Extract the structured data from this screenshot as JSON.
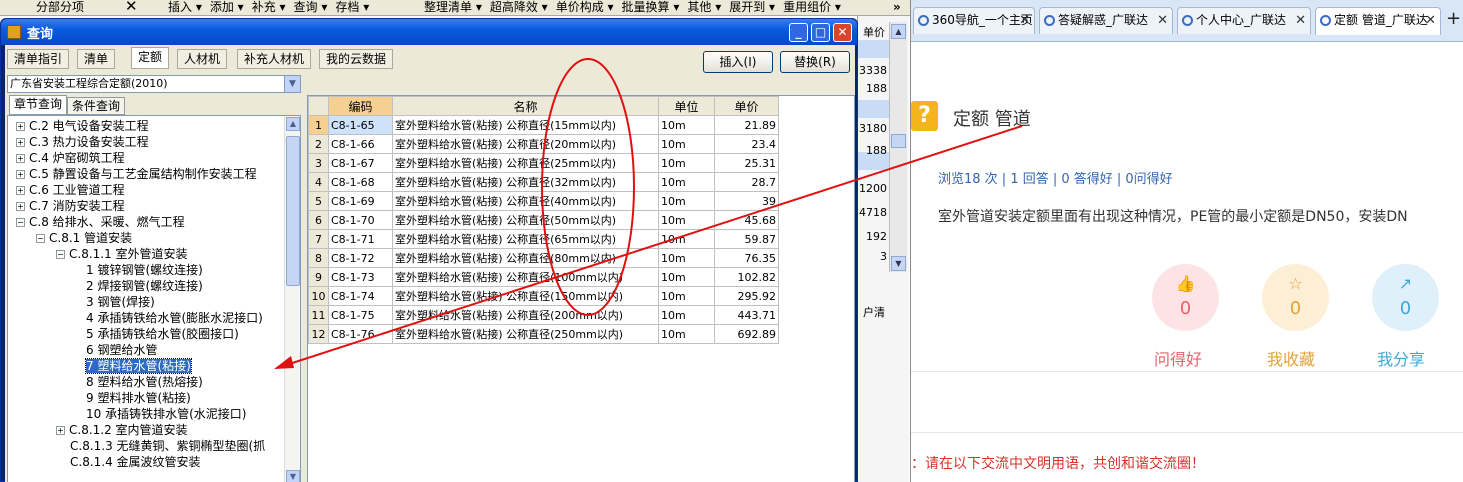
{
  "app_toolbar": {
    "section_label": "分部分项",
    "close": "✕",
    "menus": [
      "插入 ▾",
      "添加 ▾",
      "补充 ▾",
      "查询 ▾",
      "存档 ▾"
    ],
    "menus2": [
      "整理清单 ▾",
      "超高降效 ▾",
      "单价构成 ▾",
      "批量换算 ▾",
      "其他 ▾",
      "展开到 ▾",
      "重用组价 ▾"
    ],
    "overflow": "»"
  },
  "bg_column": {
    "header": "单价",
    "values": [
      "3338",
      "188",
      "3180",
      "188",
      "1200",
      "4718",
      "192",
      "3"
    ],
    "tab_text": "户清"
  },
  "dialog": {
    "title": "查询",
    "tabs": [
      "清单指引",
      "清单",
      "定额",
      "人材机",
      "补充人材机",
      "我的云数据"
    ],
    "selected_tab": "定额",
    "insert_button": "插入(I)",
    "replace_button": "替换(R)",
    "quota_library": "广东省安装工程综合定额(2010)",
    "left_tabs": [
      "章节查询",
      "条件查询"
    ],
    "tree": [
      {
        "label": "C.2 电气设备安装工程",
        "level": 0,
        "toggle": "+"
      },
      {
        "label": "C.3 热力设备安装工程",
        "level": 0,
        "toggle": "+"
      },
      {
        "label": "C.4 炉窑砌筑工程",
        "level": 0,
        "toggle": "+"
      },
      {
        "label": "C.5 静置设备与工艺金属结构制作安装工程",
        "level": 0,
        "toggle": "+"
      },
      {
        "label": "C.6 工业管道工程",
        "level": 0,
        "toggle": "+"
      },
      {
        "label": "C.7 消防安装工程",
        "level": 0,
        "toggle": "+"
      },
      {
        "label": "C.8 给排水、采暖、燃气工程",
        "level": 0,
        "toggle": "−"
      },
      {
        "label": "C.8.1 管道安装",
        "level": 1,
        "toggle": "−"
      },
      {
        "label": "C.8.1.1 室外管道安装",
        "level": 2,
        "toggle": "−"
      },
      {
        "label": "1 镀锌钢管(螺纹连接)",
        "level": 3,
        "toggle": ""
      },
      {
        "label": "2 焊接钢管(螺纹连接)",
        "level": 3,
        "toggle": ""
      },
      {
        "label": "3 钢管(焊接)",
        "level": 3,
        "toggle": ""
      },
      {
        "label": "4 承插铸铁给水管(膨胀水泥接口)",
        "level": 3,
        "toggle": ""
      },
      {
        "label": "5 承插铸铁给水管(胶圈接口)",
        "level": 3,
        "toggle": ""
      },
      {
        "label": "6 钢塑给水管",
        "level": 3,
        "toggle": ""
      },
      {
        "label": "7 塑料给水管(粘接)",
        "level": 3,
        "toggle": "",
        "selected": true
      },
      {
        "label": "8 塑料给水管(热熔接)",
        "level": 3,
        "toggle": ""
      },
      {
        "label": "9 塑料排水管(粘接)",
        "level": 3,
        "toggle": ""
      },
      {
        "label": "10 承插铸铁排水管(水泥接口)",
        "level": 3,
        "toggle": ""
      },
      {
        "label": "C.8.1.2 室内管道安装",
        "level": 2,
        "toggle": "+"
      },
      {
        "label": "C.8.1.3 无缝黄铜、紫铜椭型垫圈(抓",
        "level": 2,
        "toggle": ""
      },
      {
        "label": "C.8.1.4 金属波纹管安装",
        "level": 2,
        "toggle": ""
      }
    ],
    "grid": {
      "headers": {
        "code": "编码",
        "name": "名称",
        "unit": "单位",
        "price": "单价"
      },
      "rows": [
        {
          "n": "1",
          "code": "C8-1-65",
          "name": "室外塑料给水管(粘接) 公称直径(15mm以内)",
          "unit": "10m",
          "price": "21.89"
        },
        {
          "n": "2",
          "code": "C8-1-66",
          "name": "室外塑料给水管(粘接) 公称直径(20mm以内)",
          "unit": "10m",
          "price": "23.4"
        },
        {
          "n": "3",
          "code": "C8-1-67",
          "name": "室外塑料给水管(粘接) 公称直径(25mm以内)",
          "unit": "10m",
          "price": "25.31"
        },
        {
          "n": "4",
          "code": "C8-1-68",
          "name": "室外塑料给水管(粘接) 公称直径(32mm以内)",
          "unit": "10m",
          "price": "28.7"
        },
        {
          "n": "5",
          "code": "C8-1-69",
          "name": "室外塑料给水管(粘接) 公称直径(40mm以内)",
          "unit": "10m",
          "price": "39"
        },
        {
          "n": "6",
          "code": "C8-1-70",
          "name": "室外塑料给水管(粘接) 公称直径(50mm以内)",
          "unit": "10m",
          "price": "45.68"
        },
        {
          "n": "7",
          "code": "C8-1-71",
          "name": "室外塑料给水管(粘接) 公称直径(65mm以内)",
          "unit": "10m",
          "price": "59.87"
        },
        {
          "n": "8",
          "code": "C8-1-72",
          "name": "室外塑料给水管(粘接) 公称直径(80mm以内)",
          "unit": "10m",
          "price": "76.35"
        },
        {
          "n": "9",
          "code": "C8-1-73",
          "name": "室外塑料给水管(粘接) 公称直径(100mm以内)",
          "unit": "10m",
          "price": "102.82"
        },
        {
          "n": "10",
          "code": "C8-1-74",
          "name": "室外塑料给水管(粘接) 公称直径(150mm以内)",
          "unit": "10m",
          "price": "295.92"
        },
        {
          "n": "11",
          "code": "C8-1-75",
          "name": "室外塑料给水管(粘接) 公称直径(200mm以内)",
          "unit": "10m",
          "price": "443.71"
        },
        {
          "n": "12",
          "code": "C8-1-76",
          "name": "室外塑料给水管(粘接) 公称直径(250mm以内)",
          "unit": "10m",
          "price": "692.89"
        }
      ]
    }
  },
  "browser": {
    "tabs": [
      "360导航_一个主页",
      "答疑解惑_广联达",
      "个人中心_广联达",
      "定额 管道_广联达"
    ],
    "active_tab": 3,
    "question_title": "定额 管道",
    "stats": "浏览18 次 | 1 回答 | 0 答得好 | 0问得好",
    "body": "室外管道安装定额里面有出现这种情况，PE管的最小定额是DN50，安装DN",
    "actions": [
      {
        "label": "问得好",
        "count": "0",
        "color": "#e8626b",
        "bg": "#fde3e5"
      },
      {
        "label": "我收藏",
        "count": "0",
        "color": "#e0a23a",
        "bg": "#fdefd6"
      },
      {
        "label": "我分享",
        "count": "0",
        "color": "#3fa8d8",
        "bg": "#dff0fa"
      }
    ],
    "notice": "：请在以下交流中文明用语，共创和谐交流圈！"
  },
  "annotation_colors": {
    "mark": "#e01010"
  }
}
